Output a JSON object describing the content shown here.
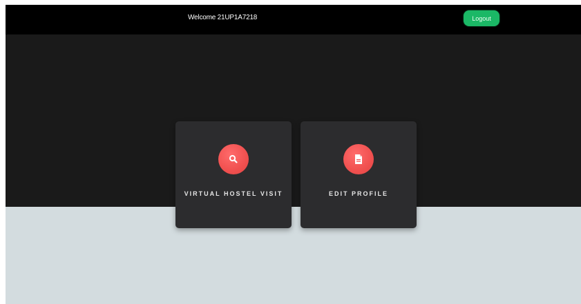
{
  "header": {
    "welcome_text": "Welcome 21UP1A7218",
    "logout_label": "Logout"
  },
  "cards": [
    {
      "label": "VIRTUAL HOSTEL VISIT",
      "icon": "search-icon"
    },
    {
      "label": "EDIT PROFILE",
      "icon": "document-icon"
    }
  ],
  "colors": {
    "topbar": "#000000",
    "hero_background": "#1a1a1a",
    "lower_background": "#d3dcdf",
    "card_background": "#2c2c2e",
    "icon_accent": "#f0504f",
    "logout_button": "#1bb866"
  }
}
